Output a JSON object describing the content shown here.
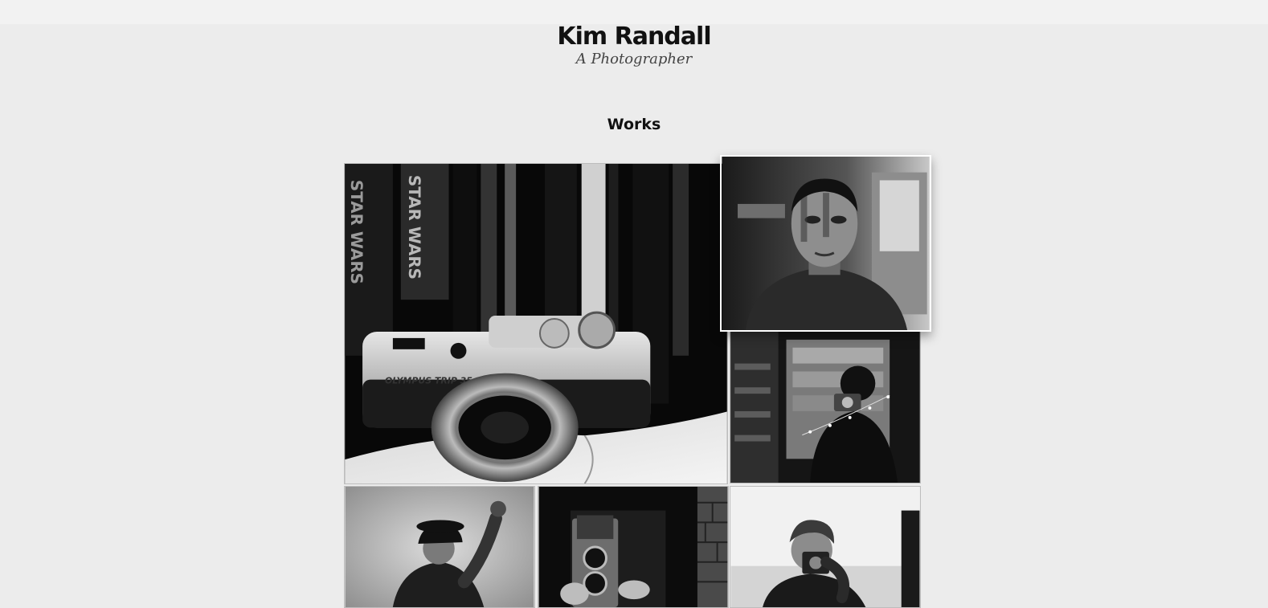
{
  "header": {
    "title": "Kim Randall",
    "subtitle": "A Photographer"
  },
  "works": {
    "heading": "Works",
    "items": [
      {
        "subject": "camera-on-book-photo",
        "camera_text": "OLYMPUS TRIP 35",
        "book_text_1": "STAR WARS",
        "book_text_2": "STAR WARS"
      },
      {
        "subject": "man-portrait-photo"
      },
      {
        "subject": "mirror-selfie-photo"
      },
      {
        "subject": "woman-waving-photo"
      },
      {
        "subject": "twin-lens-camera-photo"
      },
      {
        "subject": "man-with-camera-photo"
      }
    ]
  },
  "colors": {
    "background": "#ececec",
    "topbar": "#f2f2f2",
    "text": "#111111"
  }
}
